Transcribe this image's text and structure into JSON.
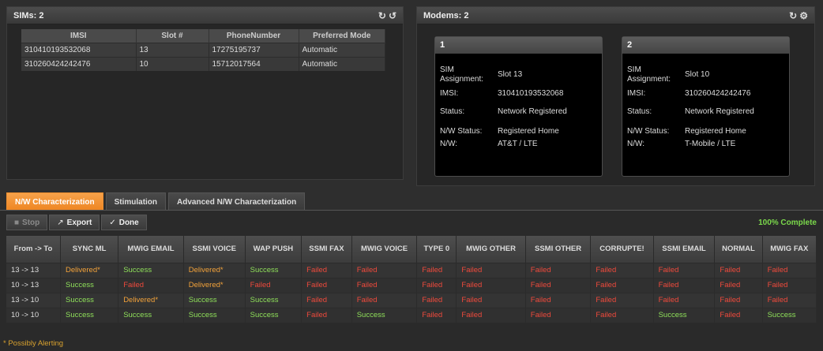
{
  "sims": {
    "title": "SIMs: 2",
    "headers": [
      "IMSI",
      "Slot #",
      "PhoneNumber",
      "Preferred Mode"
    ],
    "rows": [
      [
        "310410193532068",
        "13",
        "17275195737",
        "Automatic"
      ],
      [
        "310260424242476",
        "10",
        "15712017564",
        "Automatic"
      ]
    ]
  },
  "modems": {
    "title": "Modems: 2",
    "cards": [
      {
        "name": "1",
        "sim_assignment_label": "SIM Assignment:",
        "sim_assignment": "Slot 13",
        "imsi_label": "IMSI:",
        "imsi": "310410193532068",
        "status_label": "Status:",
        "status": "Network Registered",
        "nw_status_label": "N/W Status:",
        "nw_status": "Registered Home",
        "nw_label": "N/W:",
        "nw": "AT&T / LTE"
      },
      {
        "name": "2",
        "sim_assignment_label": "SIM Assignment:",
        "sim_assignment": "Slot 10",
        "imsi_label": "IMSI:",
        "imsi": "310260424242476",
        "status_label": "Status:",
        "status": "Network Registered",
        "nw_status_label": "N/W Status:",
        "nw_status": "Registered Home",
        "nw_label": "N/W:",
        "nw": "T-Mobile / LTE"
      }
    ]
  },
  "tabs": [
    "N/W Characterization",
    "Stimulation",
    "Advanced N/W Characterization"
  ],
  "toolbar": {
    "stop_label": "Stop",
    "export_label": "Export",
    "done_label": "Done",
    "complete_text": "100% Complete"
  },
  "results": {
    "headers": [
      "From -> To",
      "SYNC ML",
      "MWIG EMAIL",
      "SSMI VOICE",
      "WAP PUSH",
      "SSMI FAX",
      "MWIG VOICE",
      "TYPE 0",
      "MWIG OTHER",
      "SSMI OTHER",
      "CORRUPTE!",
      "SSMI EMAIL",
      "NORMAL",
      "MWIG FAX"
    ],
    "rows": [
      [
        "13 -> 13",
        "Delivered*",
        "Success",
        "Delivered*",
        "Success",
        "Failed",
        "Failed",
        "Failed",
        "Failed",
        "Failed",
        "Failed",
        "Failed",
        "Failed",
        "Failed"
      ],
      [
        "10 -> 13",
        "Success",
        "Failed",
        "Delivered*",
        "Failed",
        "Failed",
        "Failed",
        "Failed",
        "Failed",
        "Failed",
        "Failed",
        "Failed",
        "Failed",
        "Failed"
      ],
      [
        "13 -> 10",
        "Success",
        "Delivered*",
        "Success",
        "Success",
        "Failed",
        "Failed",
        "Failed",
        "Failed",
        "Failed",
        "Failed",
        "Failed",
        "Failed",
        "Failed"
      ],
      [
        "10 -> 10",
        "Success",
        "Success",
        "Success",
        "Success",
        "Failed",
        "Success",
        "Failed",
        "Failed",
        "Failed",
        "Failed",
        "Success",
        "Failed",
        "Success"
      ]
    ]
  },
  "footnote": "* Possibly Alerting",
  "colors": {
    "accent": "#ee8522",
    "success": "#8fe05a",
    "failed": "#ef4a3c",
    "delivered": "#f2a23a",
    "complete": "#7bd94b"
  }
}
